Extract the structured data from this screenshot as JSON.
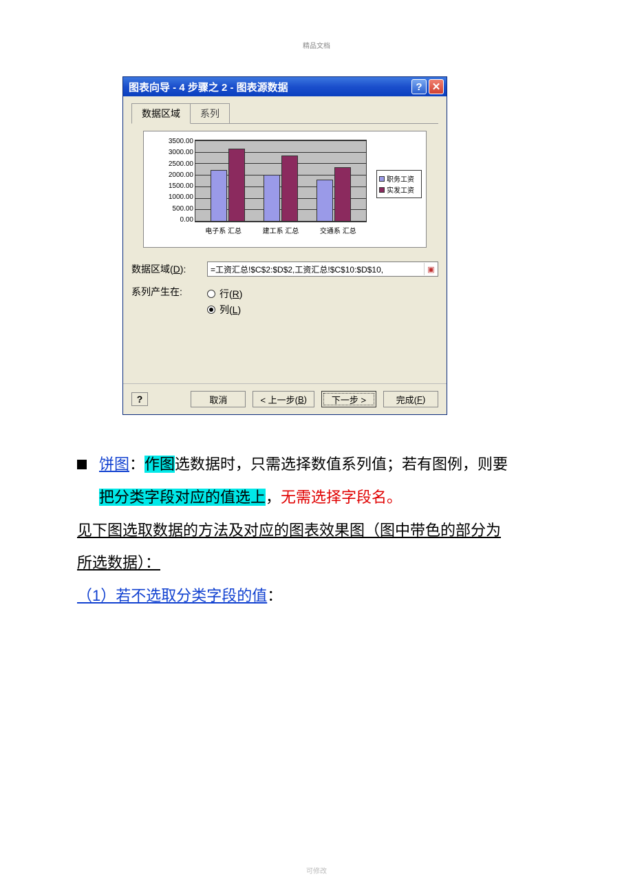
{
  "header_small": "精品文档",
  "footer_small": "可修改",
  "dialog": {
    "title": "图表向导 - 4 步骤之 2 - 图表源数据",
    "tabs": {
      "active": "数据区域",
      "inactive": "系列"
    },
    "data_range_label": "数据区域(D):",
    "data_range_value": "=工资汇总!$C$2:$D$2,工资汇总!$C$10:$D$10,",
    "series_in_label": "系列产生在:",
    "radio_row": "行(R)",
    "radio_col": "列(L)",
    "buttons": {
      "help": "?",
      "cancel": "取消",
      "back": "< 上一步(B)",
      "next": "下一步 >",
      "finish": "完成(F)"
    }
  },
  "chart_data": {
    "type": "bar",
    "categories": [
      "电子系 汇总",
      "建工系 汇总",
      "交通系 汇总"
    ],
    "series": [
      {
        "name": "职务工资",
        "values": [
          2200,
          2000,
          1800
        ]
      },
      {
        "name": "实发工资",
        "values": [
          3100,
          2800,
          2300
        ]
      }
    ],
    "ylim": [
      0,
      3500
    ],
    "yticks": [
      "3500.00",
      "3000.00",
      "2500.00",
      "2000.00",
      "1500.00",
      "1000.00",
      "500.00",
      "0.00"
    ],
    "legend": [
      "职务工资",
      "实发工资"
    ]
  },
  "doc": {
    "line1_label": "饼图",
    "line1_mid": "：",
    "line1_hl1": "作图",
    "line1_rest": "选数据时，只需选择数值系列值；若有图例，则要",
    "line2_hl": "把分类字段对应的值选上",
    "line2_rest": "，",
    "line2_red": "无需选择字段名。",
    "line3": "见下图选取数据的方法及对应的图表效果图（图中带色的部分为",
    "line4": "所选数据）：",
    "line5": "（1）若不选取分类字段的值",
    "line5_rest": "："
  }
}
